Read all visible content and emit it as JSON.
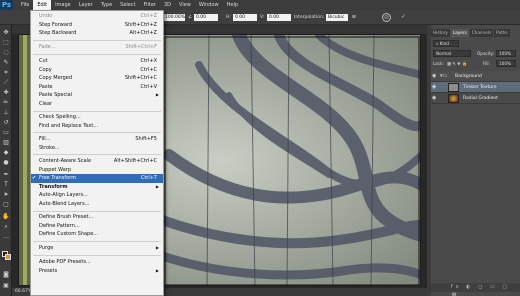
{
  "app": {
    "logo": "Ps"
  },
  "menubar": [
    "File",
    "Edit",
    "Image",
    "Layer",
    "Type",
    "Select",
    "Filter",
    "3D",
    "View",
    "Window",
    "Help"
  ],
  "options": {
    "zoom_pct": "100.00%",
    "field1": "0.00",
    "h_label": "H:",
    "field2": "0.00",
    "v_label": "V:",
    "field3": "0.00",
    "interp_label": "Interpolation:",
    "interp_value": "Bicubic"
  },
  "edit_menu": [
    {
      "label": "Undo",
      "shortcut": "Ctrl+Z"
    },
    {
      "label": "Step Forward",
      "shortcut": "Shift+Ctrl+Z"
    },
    {
      "label": "Step Backward",
      "shortcut": "Alt+Ctrl+Z"
    },
    {
      "label": "Fade...",
      "shortcut": "Shift+Ctrl+F"
    },
    {
      "label": "Cut",
      "shortcut": "Ctrl+X"
    },
    {
      "label": "Copy",
      "shortcut": "Ctrl+C"
    },
    {
      "label": "Copy Merged",
      "shortcut": "Shift+Ctrl+C"
    },
    {
      "label": "Paste",
      "shortcut": "Ctrl+V"
    },
    {
      "label": "Paste Special",
      "shortcut": ""
    },
    {
      "label": "Clear",
      "shortcut": ""
    },
    {
      "label": "Check Spelling...",
      "shortcut": ""
    },
    {
      "label": "Find and Replace Text...",
      "shortcut": ""
    },
    {
      "label": "Fill...",
      "shortcut": "Shift+F5"
    },
    {
      "label": "Stroke...",
      "shortcut": ""
    },
    {
      "label": "Content-Aware Scale",
      "shortcut": "Alt+Shift+Ctrl+C"
    },
    {
      "label": "Puppet Warp",
      "shortcut": ""
    },
    {
      "label": "Free Transform",
      "shortcut": "Ctrl+T"
    },
    {
      "label": "Transform",
      "shortcut": ""
    },
    {
      "label": "Auto-Align Layers...",
      "shortcut": ""
    },
    {
      "label": "Auto-Blend Layers...",
      "shortcut": ""
    },
    {
      "label": "Define Brush Preset...",
      "shortcut": ""
    },
    {
      "label": "Define Pattern...",
      "shortcut": ""
    },
    {
      "label": "Define Custom Shape...",
      "shortcut": ""
    },
    {
      "label": "Purge",
      "shortcut": ""
    },
    {
      "label": "Adobe PDF Presets...",
      "shortcut": ""
    },
    {
      "label": "Presets",
      "shortcut": ""
    }
  ],
  "panels": {
    "tabs": [
      "History",
      "Layers",
      "Channels",
      "Paths"
    ],
    "kind": "Kind",
    "blend_mode": "Normal",
    "opacity_label": "Opacity:",
    "opacity_value": "100%",
    "lock_label": "Lock:",
    "fill_label": "Fill:",
    "fill_value": "100%",
    "layers": [
      {
        "name": "Background"
      },
      {
        "name": "Timber Texture"
      },
      {
        "name": "Radial Gradient"
      }
    ],
    "bottom_icons": "fx ◐ ◻ ▭ ▢ 🗑"
  },
  "status": {
    "zoom": "66.67%"
  },
  "colors": {
    "accent": "#2f6db5",
    "menu_bg": "#f2f2f2",
    "ui_dark": "#3c3c3c",
    "layer_selected": "#5d6b7a"
  }
}
